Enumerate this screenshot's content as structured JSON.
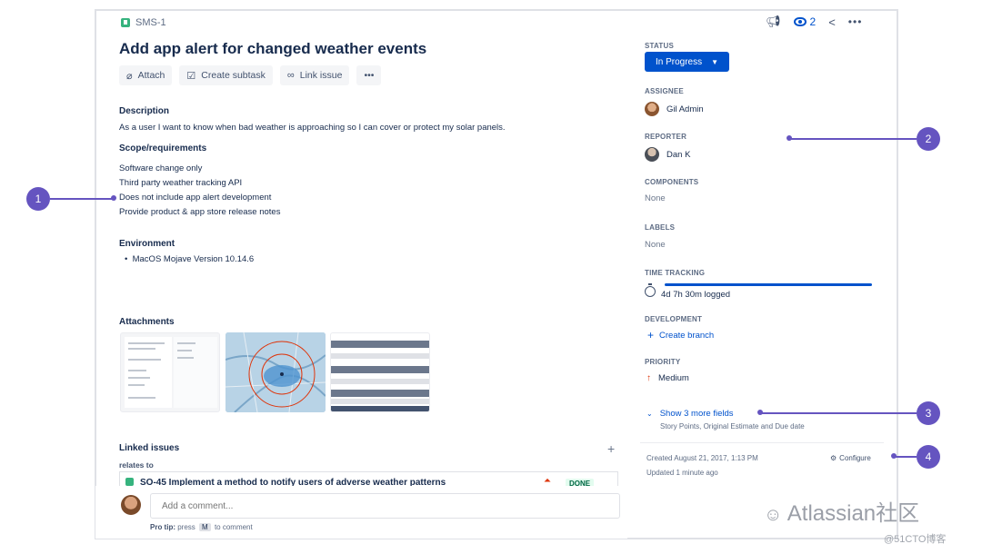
{
  "header": {
    "issue_key": "SMS-1",
    "watch_count": "2",
    "title": "Add app alert for changed weather events"
  },
  "toolbar": {
    "attach": "Attach",
    "create_subtask": "Create subtask",
    "link_issue": "Link issue",
    "more": "•••"
  },
  "description": {
    "heading": "Description",
    "text": "As a user I want to know when bad weather is approaching so I can cover or protect my solar panels.",
    "scope_heading": "Scope/requirements",
    "scope_items": [
      "Software change only",
      "Third party weather tracking API",
      "Does not include app alert development",
      "Provide product & app store release notes"
    ],
    "env_heading": "Environment",
    "env_items": [
      "MacOS Mojave Version 10.14.6"
    ]
  },
  "attachments": {
    "heading": "Attachments"
  },
  "linked": {
    "heading": "Linked issues",
    "relation": "relates to",
    "row_text": "SO-45 Implement a method to notify users of adverse weather patterns",
    "row_status": "DONE"
  },
  "comment": {
    "placeholder": "Add a comment...",
    "protip_label": "Pro tip:",
    "protip_pre": "press",
    "protip_key": "M",
    "protip_post": "to comment"
  },
  "sidebar": {
    "status_label": "STATUS",
    "status_value": "In Progress",
    "assignee_label": "ASSIGNEE",
    "assignee": "Gil Admin",
    "reporter_label": "REPORTER",
    "reporter": "Dan K",
    "components_label": "COMPONENTS",
    "components": "None",
    "labels_label": "LABELS",
    "labels": "None",
    "time_label": "TIME TRACKING",
    "time_logged": "4d 7h 30m logged",
    "dev_label": "DEVELOPMENT",
    "create_branch": "Create branch",
    "priority_label": "PRIORITY",
    "priority": "Medium",
    "more_fields": "Show 3 more fields",
    "more_fields_sub": "Story Points, Original Estimate and Due date",
    "created": "Created August 21, 2017, 1:13 PM",
    "updated": "Updated 1 minute ago",
    "configure": "Configure"
  },
  "callouts": [
    "1",
    "2",
    "3",
    "4"
  ],
  "watermark": {
    "main": "Atlassian社区",
    "sub": "@51CTO博客"
  },
  "colors": {
    "primary": "#0052cc",
    "callout": "#6554c0",
    "story": "#36b37e",
    "priority": "#de350b"
  }
}
